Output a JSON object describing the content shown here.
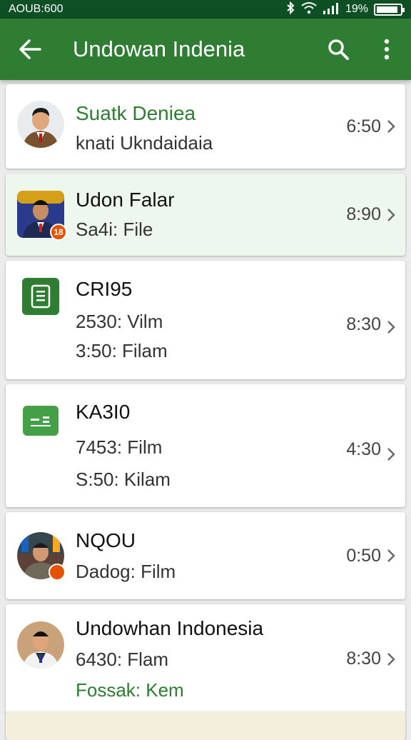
{
  "status": {
    "left": "AOUB:600",
    "battery": "19%"
  },
  "appbar": {
    "title": "Undowan Indenia",
    "back_icon": "arrow-left-icon",
    "search_icon": "search-icon",
    "menu_icon": "more-vert-icon"
  },
  "colors": {
    "primary": "#2e7d32",
    "status_bar": "#0e4f24",
    "badge": "#e65100"
  },
  "items": [
    {
      "name": "Suatk Deniea",
      "lines": [
        "knati Ukndaidaia"
      ],
      "time": "6:50"
    },
    {
      "name": "Udon Falar",
      "lines": [
        "Sa4i: File"
      ],
      "time": "8:90",
      "badge": "18"
    },
    {
      "name": "CRI95",
      "lines": [
        "2530: Vilm",
        "3:50: Filam"
      ],
      "time": "8:30"
    },
    {
      "name": "KA3I0",
      "lines": [
        "7453: Film",
        "S:50: Kilam"
      ],
      "time": "4:30"
    },
    {
      "name": "NQOU",
      "lines": [
        "Dadog: Film"
      ],
      "time": "0:50"
    },
    {
      "name": "Undowhan Indonesia",
      "lines": [
        "6430: Flam",
        "Fossak: Kem"
      ],
      "time": "8:30"
    }
  ]
}
